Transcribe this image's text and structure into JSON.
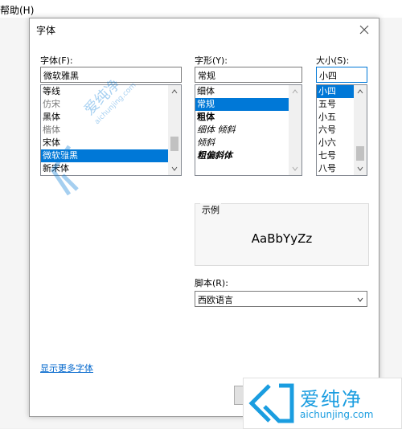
{
  "background": {
    "menu_item": "帮助(H)"
  },
  "dialog": {
    "title": "字体",
    "font": {
      "label": "字体(F):",
      "value": "微软雅黑",
      "items": [
        {
          "text": "等线"
        },
        {
          "text": "仿宋"
        },
        {
          "text": "黑体"
        },
        {
          "text": "楷体"
        },
        {
          "text": "宋体"
        },
        {
          "text": "微软雅黑",
          "selected": true
        },
        {
          "text": "新宋体"
        }
      ]
    },
    "style": {
      "label": "字形(Y):",
      "value": "常规",
      "items": [
        {
          "text": "细体"
        },
        {
          "text": "常规",
          "selected": true
        },
        {
          "text": "粗体"
        },
        {
          "text": "细体 倾斜"
        },
        {
          "text": "倾斜"
        },
        {
          "text": "粗偏斜体"
        }
      ]
    },
    "size": {
      "label": "大小(S):",
      "value": "小四",
      "items": [
        {
          "text": "小四",
          "selected": true
        },
        {
          "text": "五号"
        },
        {
          "text": "小五"
        },
        {
          "text": "六号"
        },
        {
          "text": "小六"
        },
        {
          "text": "七号"
        },
        {
          "text": "八号"
        }
      ]
    },
    "sample": {
      "label": "示例",
      "text": "AaBbYyZz"
    },
    "script": {
      "label": "脚本(R):",
      "value": "西欧语言"
    },
    "more_fonts_link": "显示更多字体"
  },
  "watermark": {
    "name": "爱纯净",
    "domain": "aichunjing.com"
  },
  "colors": {
    "accent": "#0078d7",
    "link": "#0066cc",
    "logo": "#1a9de0"
  }
}
